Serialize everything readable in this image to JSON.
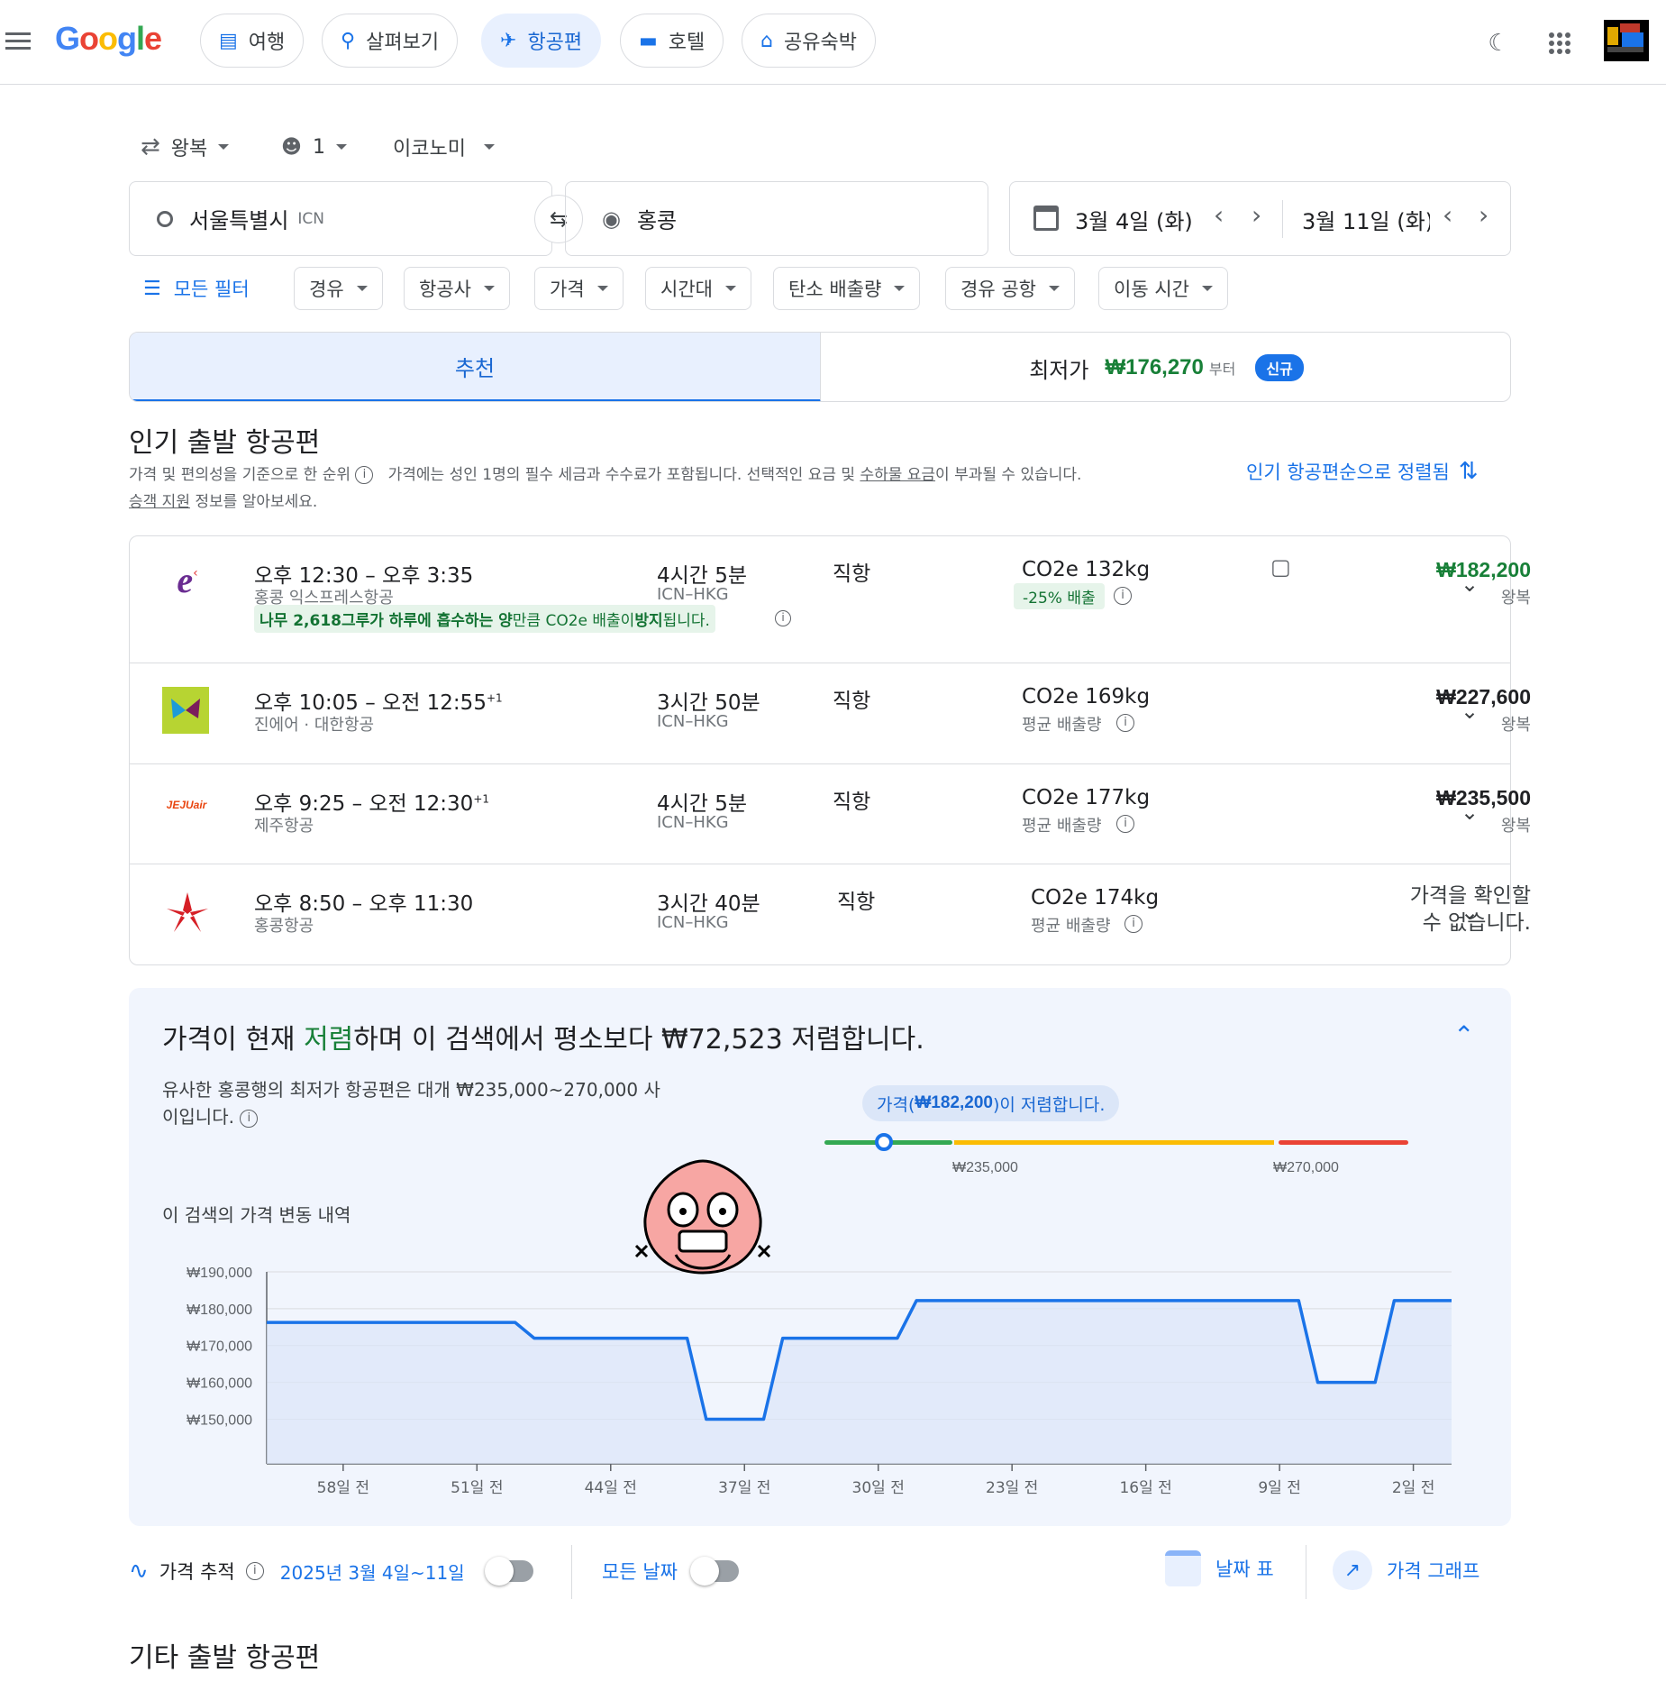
{
  "header": {
    "logo": "Google",
    "tabs": [
      {
        "label": "여행",
        "icon": "luggage-icon"
      },
      {
        "label": "살펴보기",
        "icon": "explore-icon"
      },
      {
        "label": "항공편",
        "icon": "flight-icon"
      },
      {
        "label": "호텔",
        "icon": "hotel-icon"
      },
      {
        "label": "공유숙박",
        "icon": "home-icon"
      }
    ]
  },
  "search": {
    "trip_type": "왕복",
    "passengers": "1",
    "cabin": "이코노미",
    "origin": "서울특별시",
    "origin_code": "ICN",
    "destination": "홍콩",
    "depart_date": "3월 4일 (화)",
    "return_date": "3월 11일 (화)"
  },
  "filters": {
    "all": "모든 필터",
    "items": [
      "경유",
      "항공사",
      "가격",
      "시간대",
      "탄소 배출량",
      "경유 공항",
      "이동 시간"
    ]
  },
  "result_tabs": {
    "recommended": "추천",
    "cheapest_label": "최저가",
    "cheapest_price": "₩176,270",
    "cheapest_suffix": "부터",
    "badge": "신규"
  },
  "popular": {
    "title": "인기 출발 항공편",
    "note1": "가격 및 편의성을 기준으로 한 순위",
    "note2_a": "가격에는 성인 1명의 필수 세금과 수수료가 포함됩니다. 선택적인 요금 및 ",
    "note2_link": "수하물 요금",
    "note2_b": "이 부과될 수 있습니다.",
    "note3_link": "승객 지원",
    "note3_b": " 정보를 알아보세요.",
    "sort": "인기 항공편순으로 정렬됨"
  },
  "flights": [
    {
      "time": "오후 12:30 – 오후 3:35",
      "plus": "",
      "airline": "홍콩 익스프레스항공",
      "duration": "4시간 5분",
      "route": "ICN–HKG",
      "stops": "직항",
      "co2": "CO2e 132kg",
      "co2_note": "-25% 배출",
      "price": "₩182,200",
      "price_note": "왕복",
      "eco_a": "나무 2,618그루가 하루에 흡수하는 양",
      "eco_b": "만큼 CO2e 배출이 ",
      "eco_c": "방지",
      "eco_d": "됩니다."
    },
    {
      "time": "오후 10:05 – 오전 12:55",
      "plus": "+1",
      "airline": "진에어 · 대한항공",
      "duration": "3시간 50분",
      "route": "ICN–HKG",
      "stops": "직항",
      "co2": "CO2e 169kg",
      "co2_note": "평균 배출량",
      "price": "₩227,600",
      "price_note": "왕복"
    },
    {
      "time": "오후 9:25 – 오전 12:30",
      "plus": "+1",
      "airline": "제주항공",
      "duration": "4시간 5분",
      "route": "ICN–HKG",
      "stops": "직항",
      "co2": "CO2e 177kg",
      "co2_note": "평균 배출량",
      "price": "₩235,500",
      "price_note": "왕복",
      "logo_text": "JEJUair"
    },
    {
      "time": "오후 8:50 – 오후 11:30",
      "plus": "",
      "airline": "홍콩항공",
      "duration": "3시간 40분",
      "route": "ICN–HKG",
      "stops": "직항",
      "co2": "CO2e 174kg",
      "co2_note": "평균 배출량",
      "price_line1": "가격을 확인할",
      "price_line2": "수 없습니다."
    }
  ],
  "insight": {
    "headline_a": "가격이 현재 ",
    "headline_b": "저렴",
    "headline_c": "하며 이 검색에서 평소보다 ₩72,523 저렴합니다.",
    "typical_a": "유사한 홍콩행의 최저가 항공편은 대개 ₩235,000~270,000 사",
    "typical_b": "이입니다.",
    "bubble_a": "가격(",
    "bubble_b": "₩182,200",
    "bubble_c": ")이 저렴합니다.",
    "range_low": "₩235,000",
    "range_high": "₩270,000",
    "history_title": "이 검색의 가격 변동 내역"
  },
  "chart_data": {
    "type": "line",
    "title": "이 검색의 가격 변동 내역",
    "ylim": [
      144000,
      190000
    ],
    "yticks": [
      150000,
      160000,
      170000,
      180000,
      190000
    ],
    "ytick_labels": [
      "₩150,000",
      "₩160,000",
      "₩170,000",
      "₩180,000",
      "₩190,000"
    ],
    "xlim": [
      -62,
      0
    ],
    "xticks": [
      -58,
      -51,
      -44,
      -37,
      -30,
      -23,
      -16,
      -9,
      -2
    ],
    "xtick_labels": [
      "58일 전",
      "51일 전",
      "44일 전",
      "37일 전",
      "30일 전",
      "23일 전",
      "16일 전",
      "9일 전",
      "2일 전"
    ],
    "series": [
      {
        "x": [
          -62,
          -49,
          -48,
          -40,
          -39,
          -36,
          -35,
          -32,
          -31,
          -29,
          -28,
          -8,
          -7,
          -4,
          -3,
          0
        ],
        "values": [
          176270,
          176270,
          172000,
          172000,
          150000,
          150000,
          172000,
          172000,
          172000,
          172000,
          182200,
          182200,
          160000,
          160000,
          182200,
          182200
        ]
      }
    ],
    "colors": {
      "line": "#1a73e8",
      "area": "#dbe6f8"
    }
  },
  "bottom": {
    "track_label": "가격 추적",
    "track_dates": "2025년 3월 4일~11일",
    "any_dates": "모든 날짜",
    "date_grid": "날짜 표",
    "price_graph": "가격 그래프"
  },
  "other": {
    "title": "기타 출발 항공편"
  }
}
